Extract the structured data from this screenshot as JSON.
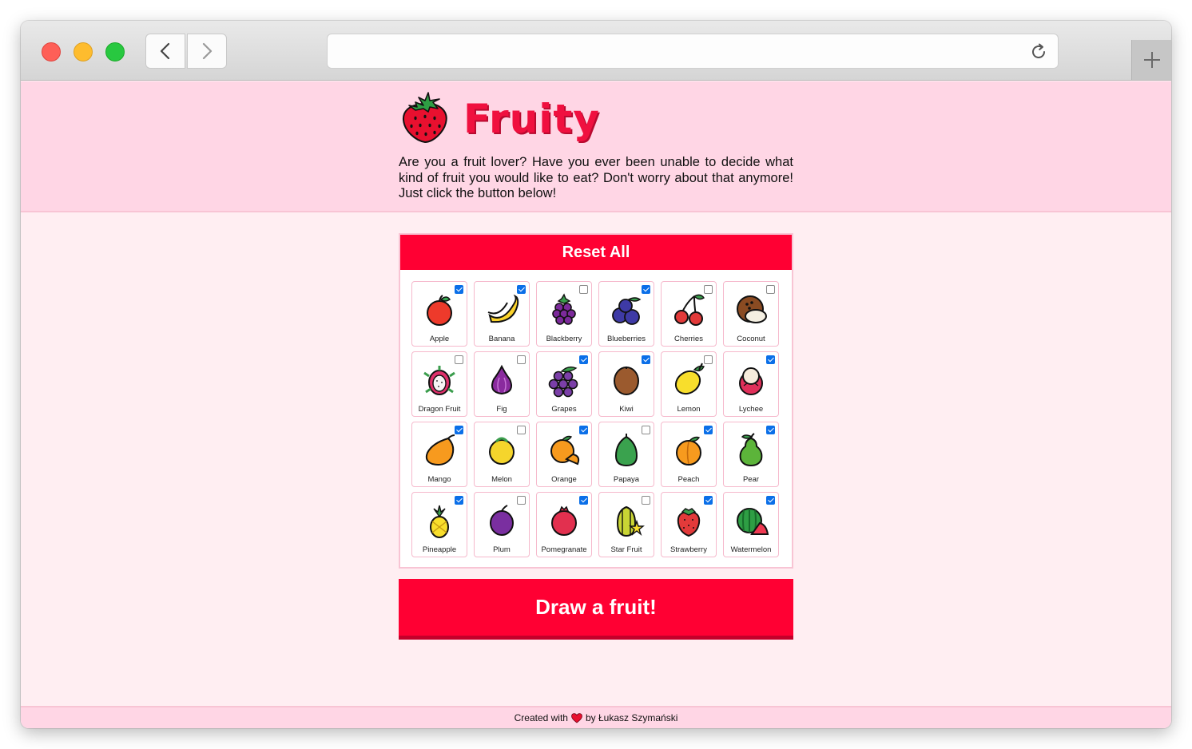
{
  "browser": {
    "url": ""
  },
  "header": {
    "brand": "Fruity",
    "intro": "Are you a fruit lover? Have you ever been unable to decide what kind of fruit you would like to eat? Don't worry about that anymore! Just click the button below!"
  },
  "panel": {
    "reset_label": "Reset All"
  },
  "fruits": [
    {
      "name": "Apple",
      "checked": true,
      "icon": "apple-icon"
    },
    {
      "name": "Banana",
      "checked": true,
      "icon": "banana-icon"
    },
    {
      "name": "Blackberry",
      "checked": false,
      "icon": "blackberry-icon"
    },
    {
      "name": "Blueberries",
      "checked": true,
      "icon": "blueberries-icon"
    },
    {
      "name": "Cherries",
      "checked": false,
      "icon": "cherries-icon"
    },
    {
      "name": "Coconut",
      "checked": false,
      "icon": "coconut-icon"
    },
    {
      "name": "Dragon Fruit",
      "checked": false,
      "icon": "dragon-fruit-icon"
    },
    {
      "name": "Fig",
      "checked": false,
      "icon": "fig-icon"
    },
    {
      "name": "Grapes",
      "checked": true,
      "icon": "grapes-icon"
    },
    {
      "name": "Kiwi",
      "checked": true,
      "icon": "kiwi-icon"
    },
    {
      "name": "Lemon",
      "checked": false,
      "icon": "lemon-icon"
    },
    {
      "name": "Lychee",
      "checked": true,
      "icon": "lychee-icon"
    },
    {
      "name": "Mango",
      "checked": true,
      "icon": "mango-icon"
    },
    {
      "name": "Melon",
      "checked": false,
      "icon": "melon-icon"
    },
    {
      "name": "Orange",
      "checked": true,
      "icon": "orange-icon"
    },
    {
      "name": "Papaya",
      "checked": false,
      "icon": "papaya-icon"
    },
    {
      "name": "Peach",
      "checked": true,
      "icon": "peach-icon"
    },
    {
      "name": "Pear",
      "checked": true,
      "icon": "pear-icon"
    },
    {
      "name": "Pineapple",
      "checked": true,
      "icon": "pineapple-icon"
    },
    {
      "name": "Plum",
      "checked": false,
      "icon": "plum-icon"
    },
    {
      "name": "Pomegranate",
      "checked": true,
      "icon": "pomegranate-icon"
    },
    {
      "name": "Star Fruit",
      "checked": false,
      "icon": "star-fruit-icon"
    },
    {
      "name": "Strawberry",
      "checked": true,
      "icon": "strawberry-icon"
    },
    {
      "name": "Watermelon",
      "checked": true,
      "icon": "watermelon-icon"
    }
  ],
  "draw_label": "Draw a fruit!",
  "footer": {
    "prefix": "Created with",
    "suffix": "by Łukasz Szymański"
  },
  "colors": {
    "accent": "#ff0033",
    "header_bg": "#ffd6e5",
    "page_bg": "#ffeef2",
    "brand": "#f0103f"
  }
}
